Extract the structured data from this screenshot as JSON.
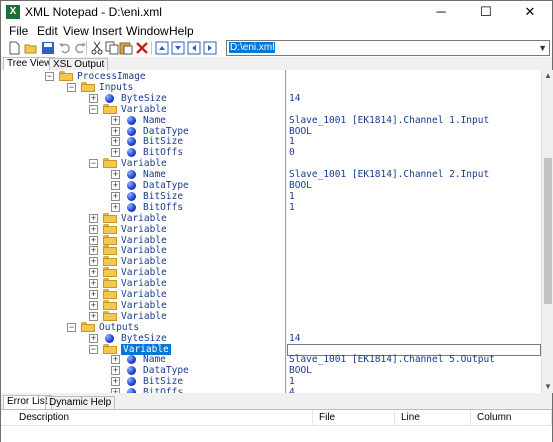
{
  "window": {
    "title": "XML Notepad - D:\\eni.xml",
    "app_icon_letter": "X",
    "minimize": "─",
    "maximize": "☐",
    "close": "✕"
  },
  "menu": [
    "File",
    "Edit",
    "View",
    "Insert",
    "Window",
    "Help"
  ],
  "toolbar": {
    "location": "D:\\eni.xml"
  },
  "tabs": {
    "tree_view": "Tree View",
    "xsl_output": "XSL Output"
  },
  "tree": [
    {
      "type": "folder",
      "label": "ProcessImage",
      "level": 0,
      "expanded": true,
      "value": ""
    },
    {
      "type": "folder",
      "label": "Inputs",
      "level": 1,
      "expanded": true,
      "value": ""
    },
    {
      "type": "attr",
      "label": "ByteSize",
      "level": 2,
      "expanded": false,
      "value": "14"
    },
    {
      "type": "folder",
      "label": "Variable",
      "level": 2,
      "expanded": true,
      "value": ""
    },
    {
      "type": "attr",
      "label": "Name",
      "level": 3,
      "expanded": false,
      "value": "Slave_1001 [EK1814].Channel 1.Input"
    },
    {
      "type": "attr",
      "label": "DataType",
      "level": 3,
      "expanded": false,
      "value": "BOOL"
    },
    {
      "type": "attr",
      "label": "BitSize",
      "level": 3,
      "expanded": false,
      "value": "1"
    },
    {
      "type": "attr",
      "label": "BitOffs",
      "level": 3,
      "expanded": false,
      "value": "0"
    },
    {
      "type": "folder",
      "label": "Variable",
      "level": 2,
      "expanded": true,
      "value": ""
    },
    {
      "type": "attr",
      "label": "Name",
      "level": 3,
      "expanded": false,
      "value": "Slave_1001 [EK1814].Channel 2.Input"
    },
    {
      "type": "attr",
      "label": "DataType",
      "level": 3,
      "expanded": false,
      "value": "BOOL"
    },
    {
      "type": "attr",
      "label": "BitSize",
      "level": 3,
      "expanded": false,
      "value": "1"
    },
    {
      "type": "attr",
      "label": "BitOffs",
      "level": 3,
      "expanded": false,
      "value": "1"
    },
    {
      "type": "folder",
      "label": "Variable",
      "level": 2,
      "expanded": false,
      "value": ""
    },
    {
      "type": "folder",
      "label": "Variable",
      "level": 2,
      "expanded": false,
      "value": ""
    },
    {
      "type": "folder",
      "label": "Variable",
      "level": 2,
      "expanded": false,
      "value": ""
    },
    {
      "type": "folder",
      "label": "Variable",
      "level": 2,
      "expanded": false,
      "value": ""
    },
    {
      "type": "folder",
      "label": "Variable",
      "level": 2,
      "expanded": false,
      "value": ""
    },
    {
      "type": "folder",
      "label": "Variable",
      "level": 2,
      "expanded": false,
      "value": ""
    },
    {
      "type": "folder",
      "label": "Variable",
      "level": 2,
      "expanded": false,
      "value": ""
    },
    {
      "type": "folder",
      "label": "Variable",
      "level": 2,
      "expanded": false,
      "value": ""
    },
    {
      "type": "folder",
      "label": "Variable",
      "level": 2,
      "expanded": false,
      "value": ""
    },
    {
      "type": "folder",
      "label": "Variable",
      "level": 2,
      "expanded": false,
      "value": ""
    },
    {
      "type": "folder",
      "label": "Outputs",
      "level": 1,
      "expanded": true,
      "value": ""
    },
    {
      "type": "attr",
      "label": "ByteSize",
      "level": 2,
      "expanded": false,
      "value": "14"
    },
    {
      "type": "folder",
      "label": "Variable",
      "level": 2,
      "expanded": true,
      "value": "",
      "selected": true
    },
    {
      "type": "attr",
      "label": "Name",
      "level": 3,
      "expanded": false,
      "value": "Slave_1001 [EK1814].Channel 5.Output"
    },
    {
      "type": "attr",
      "label": "DataType",
      "level": 3,
      "expanded": false,
      "value": "BOOL"
    },
    {
      "type": "attr",
      "label": "BitSize",
      "level": 3,
      "expanded": false,
      "value": "1"
    },
    {
      "type": "attr",
      "label": "BitOffs",
      "level": 3,
      "expanded": false,
      "value": "4"
    }
  ],
  "bottom_tabs": {
    "error_list": "Error List",
    "dynamic_help": "Dynamic Help"
  },
  "error_columns": [
    "Description",
    "File",
    "Line",
    "Column"
  ]
}
